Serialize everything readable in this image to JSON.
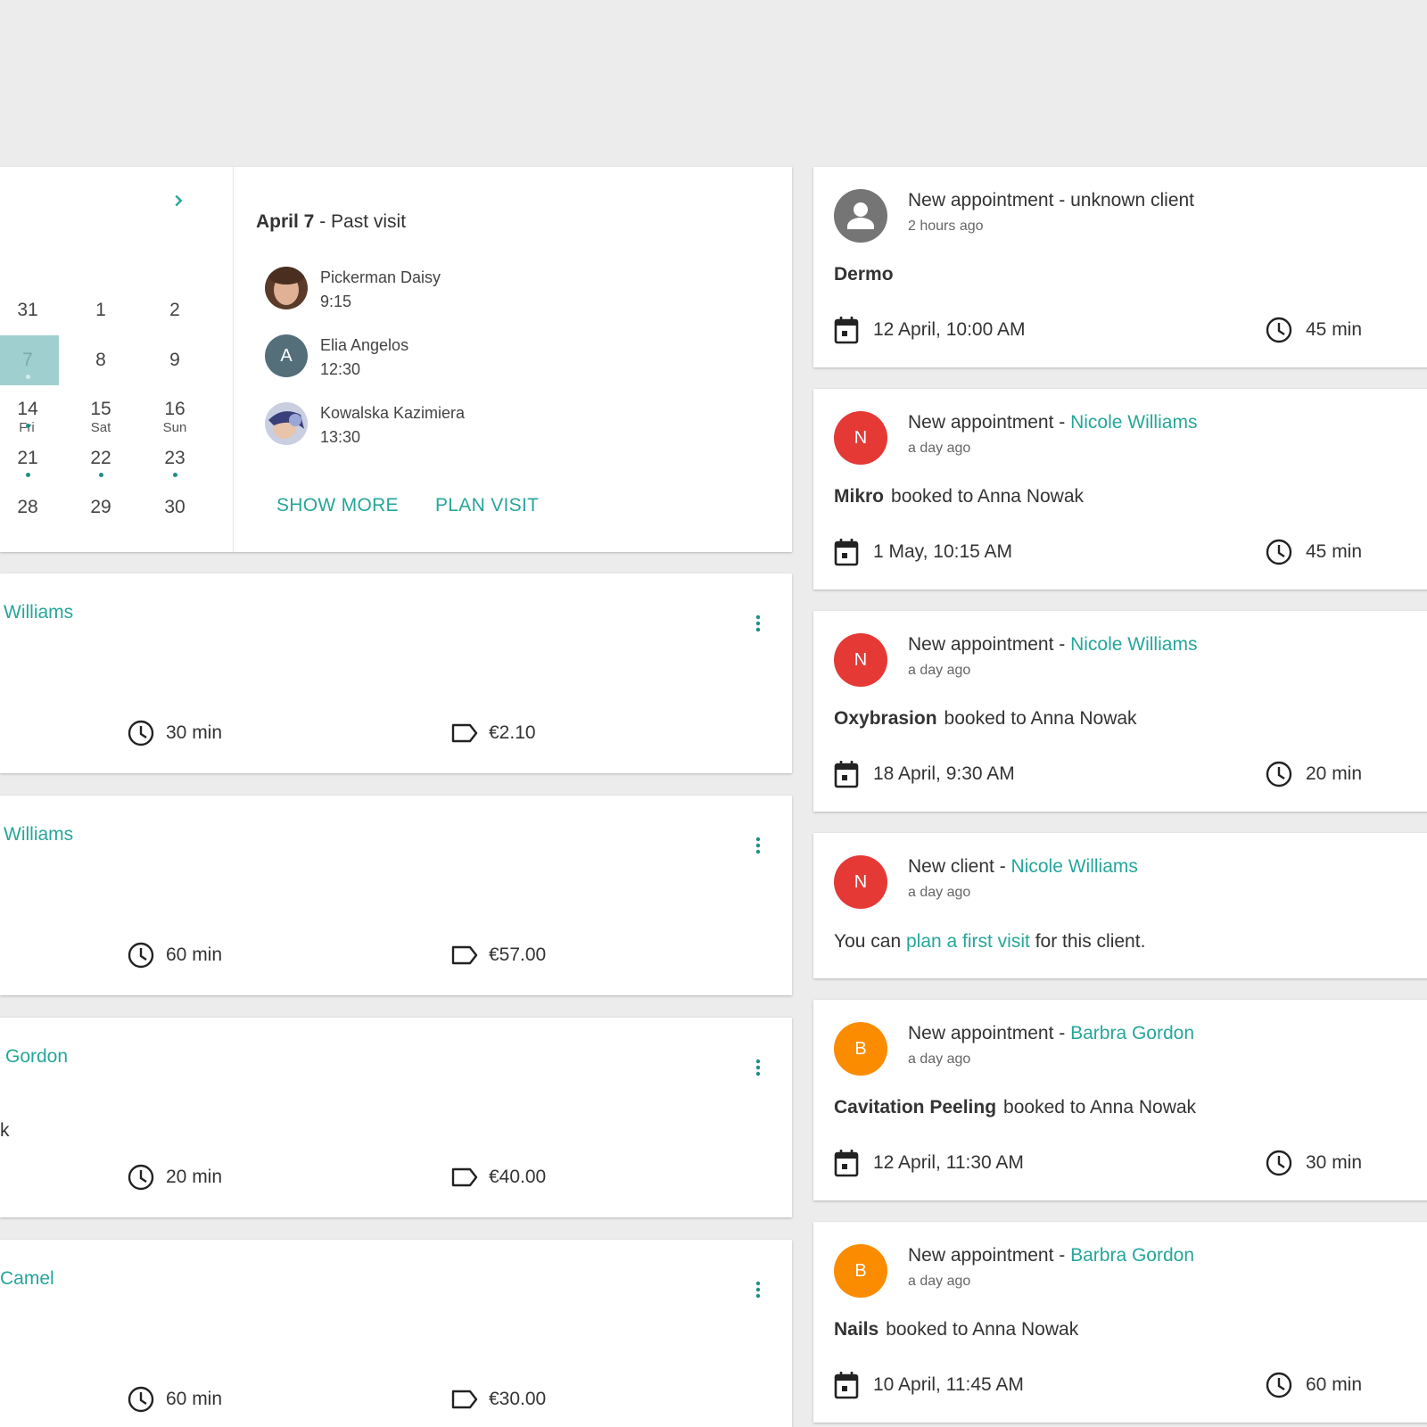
{
  "calendar": {
    "weekdays": [
      "Fri",
      "Sat",
      "Sun"
    ],
    "rows": [
      [
        "31",
        "1",
        "2"
      ],
      [
        "7",
        "8",
        "9"
      ],
      [
        "14",
        "15",
        "16"
      ],
      [
        "21",
        "22",
        "23"
      ],
      [
        "28",
        "29",
        "30"
      ]
    ],
    "selected_day": "7",
    "next_icon": "chevron-right-icon"
  },
  "past_visit": {
    "date": "April 7",
    "title_suffix": " - Past visit",
    "visits": [
      {
        "name": "Pickerman Daisy",
        "time": "9:15",
        "avatar": "photo"
      },
      {
        "name": "Elia Angelos",
        "time": "12:30",
        "avatar": "A"
      },
      {
        "name": "Kowalska Kazimiera",
        "time": "13:30",
        "avatar": "photo"
      }
    ],
    "show_more_label": "SHOW MORE",
    "plan_visit_label": "PLAN VISIT"
  },
  "appointments": [
    {
      "client": "Williams",
      "extra": "",
      "duration": "30 min",
      "price": "€2.10"
    },
    {
      "client": "Williams",
      "extra": "",
      "duration": "60 min",
      "price": "€57.00"
    },
    {
      "client": "Gordon",
      "extra": "k",
      "duration": "20 min",
      "price": "€40.00"
    },
    {
      "client": "Camel",
      "extra": "",
      "duration": "60 min",
      "price": "€30.00"
    }
  ],
  "notifications": [
    {
      "title": "New appointment - unknown client",
      "time": "2 hours ago",
      "avatar": "person-icon",
      "service": "Dermo",
      "booked": "",
      "date": "12 April, 10:00 AM",
      "duration": "45 min"
    },
    {
      "title": "New appointment - ",
      "client": "Nicole Williams",
      "time": "a day ago",
      "avatar": "N",
      "service": "Mikro",
      "booked": "booked to Anna Nowak",
      "date": "1 May, 10:15 AM",
      "duration": "45 min"
    },
    {
      "title": "New appointment - ",
      "client": "Nicole Williams",
      "time": "a day ago",
      "avatar": "N",
      "service": "Oxybrasion",
      "booked": "booked to Anna Nowak",
      "date": "18 April, 9:30 AM",
      "duration": "20 min"
    },
    {
      "title": "New client - ",
      "client": "Nicole Williams",
      "time": "a day ago",
      "avatar": "N",
      "body_prefix": "You can ",
      "body_link": "plan a first visit",
      "body_suffix": " for this client."
    },
    {
      "title": "New appointment - ",
      "client": "Barbra Gordon",
      "time": "a day ago",
      "avatar": "B",
      "service": "Cavitation Peeling",
      "booked": "booked to Anna Nowak",
      "date": "12 April, 11:30 AM",
      "duration": "30 min"
    },
    {
      "title": "New appointment - ",
      "client": "Barbra Gordon",
      "time": "a day ago",
      "avatar": "B",
      "service": "Nails",
      "booked": "booked to Anna Nowak",
      "date": "10 April, 11:45 AM",
      "duration": "60 min"
    }
  ],
  "colors": {
    "accent": "#26a69a",
    "avatar_red": "#e53935",
    "avatar_orange": "#fb8c00",
    "avatar_grey": "#757575",
    "avatar_slate": "#546e7a",
    "selected_day": "#9fd0cf"
  }
}
